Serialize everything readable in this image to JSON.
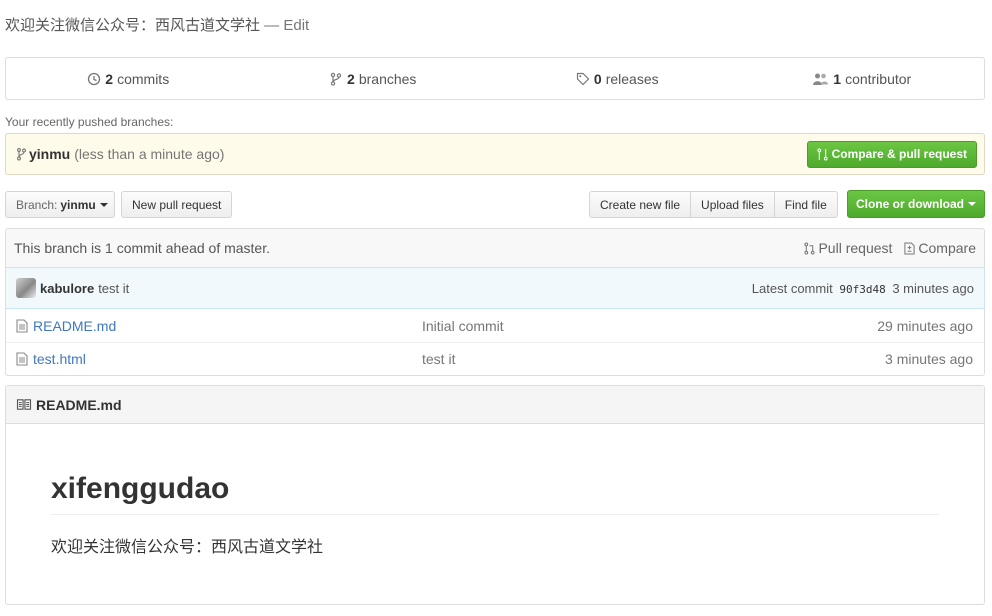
{
  "repo": {
    "description": "欢迎关注微信公众号：西风古道文学社",
    "separator": " — ",
    "edit_label": "Edit"
  },
  "summary": {
    "commits": {
      "count": "2",
      "label": "commits",
      "icon": "history-icon"
    },
    "branches": {
      "count": "2",
      "label": "branches",
      "icon": "git-branch-icon"
    },
    "releases": {
      "count": "0",
      "label": "releases",
      "icon": "tag-icon"
    },
    "contributors": {
      "count": "1",
      "label": "contributor",
      "icon": "people-icon"
    }
  },
  "recent": {
    "label": "Your recently pushed branches:",
    "branch": "yinmu",
    "time": "(less than a minute ago)",
    "compare_button": "Compare & pull request"
  },
  "file_nav": {
    "branch_label": "Branch:",
    "branch_value": "yinmu",
    "new_pr": "New pull request",
    "create_file": "Create new file",
    "upload_files": "Upload files",
    "find_file": "Find file",
    "clone": "Clone or download"
  },
  "branch_info": {
    "text": "This branch is 1 commit ahead of master.",
    "pull_request": "Pull request",
    "compare": "Compare"
  },
  "latest_commit": {
    "author": "kabulore",
    "message": "test it",
    "label": "Latest commit",
    "sha": "90f3d48",
    "age": "3 minutes ago"
  },
  "files": [
    {
      "name": "README.md",
      "message": "Initial commit",
      "age": "29 minutes ago"
    },
    {
      "name": "test.html",
      "message": "test it",
      "age": "3 minutes ago"
    }
  ],
  "readme": {
    "filename": "README.md",
    "heading": "xifenggudao",
    "paragraph": "欢迎关注微信公众号：西风古道文学社"
  },
  "colors": {
    "link": "#4078c0",
    "green_button": "#6cc644",
    "recent_bar": "#fffbea"
  }
}
